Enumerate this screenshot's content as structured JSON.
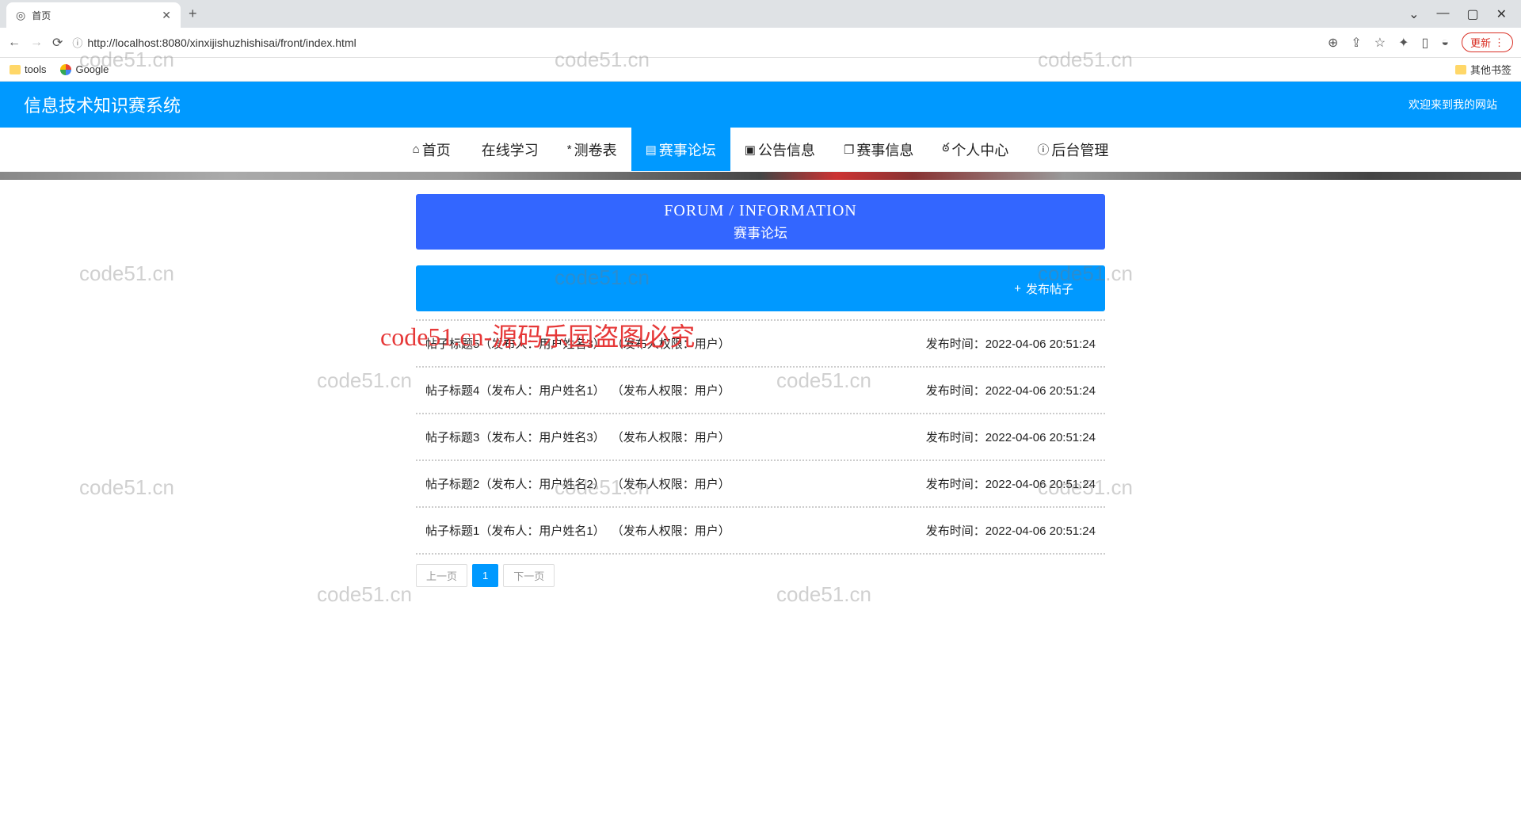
{
  "browser": {
    "tab_title": "首页",
    "url": "http://localhost:8080/xinxijishuzhishisai/front/index.html",
    "update_label": "更新",
    "bookmarks": {
      "tools": "tools",
      "google": "Google",
      "other": "其他书签"
    }
  },
  "site": {
    "title": "信息技术知识赛系统",
    "welcome": "欢迎来到我的网站"
  },
  "nav": [
    {
      "icon": "⌂",
      "label": "首页"
    },
    {
      "icon": "",
      "label": "在线学习"
    },
    {
      "icon": "*",
      "label": "测卷表"
    },
    {
      "icon": "▤",
      "label": "赛事论坛"
    },
    {
      "icon": "▣",
      "label": "公告信息"
    },
    {
      "icon": "❐",
      "label": "赛事信息"
    },
    {
      "icon": "ఠ",
      "label": "个人中心"
    },
    {
      "icon": "ⓘ",
      "label": "后台管理"
    }
  ],
  "section": {
    "en": "FORUM / INFORMATION",
    "cn": "赛事论坛"
  },
  "publish": {
    "label": "发布帖子"
  },
  "posts": [
    {
      "title": "帖子标题5（发布人：用户姓名3）",
      "perm": "（发布人权限：用户）",
      "time_label": "发布时间：",
      "time": "2022-04-06 20:51:24"
    },
    {
      "title": "帖子标题4（发布人：用户姓名1）",
      "perm": "（发布人权限：用户）",
      "time_label": "发布时间：",
      "time": "2022-04-06 20:51:24"
    },
    {
      "title": "帖子标题3（发布人：用户姓名3）",
      "perm": "（发布人权限：用户）",
      "time_label": "发布时间：",
      "time": "2022-04-06 20:51:24"
    },
    {
      "title": "帖子标题2（发布人：用户姓名2）",
      "perm": "（发布人权限：用户）",
      "time_label": "发布时间：",
      "time": "2022-04-06 20:51:24"
    },
    {
      "title": "帖子标题1（发布人：用户姓名1）",
      "perm": "（发布人权限：用户）",
      "time_label": "发布时间：",
      "time": "2022-04-06 20:51:24"
    }
  ],
  "pagination": {
    "prev": "上一页",
    "current": "1",
    "next": "下一页"
  },
  "watermark": "code51.cn",
  "red_watermark": "code51.cn-源码乐园盗图必究"
}
